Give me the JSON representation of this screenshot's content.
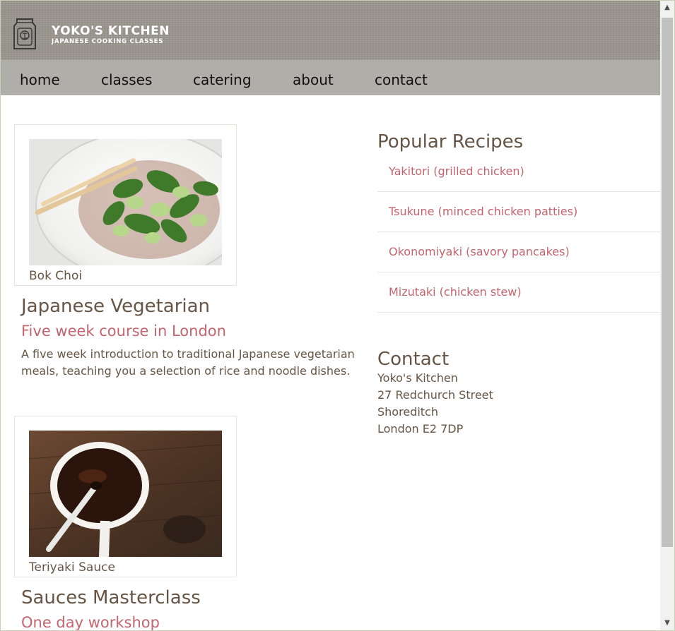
{
  "brand": {
    "title": "YOKO'S KITCHEN",
    "subtitle": "JAPANESE COOKING CLASSES",
    "logo_icon": "jar-logo-icon"
  },
  "nav": {
    "items": [
      {
        "label": "home"
      },
      {
        "label": "classes"
      },
      {
        "label": "catering"
      },
      {
        "label": "about"
      },
      {
        "label": "contact"
      }
    ]
  },
  "articles": [
    {
      "caption": "Bok Choi",
      "title": "Japanese Vegetarian",
      "subtitle": "Five week course in London",
      "body": "A five week introduction to traditional Japanese vegetarian meals, teaching you a selection of rice and noodle dishes."
    },
    {
      "caption": "Teriyaki Sauce",
      "title": "Sauces Masterclass",
      "subtitle": "One day workshop"
    }
  ],
  "aside": {
    "recipes_title": "Popular Recipes",
    "recipes": [
      {
        "label": "Yakitori (grilled chicken)"
      },
      {
        "label": "Tsukune (minced chicken patties)"
      },
      {
        "label": "Okonomiyaki (savory pancakes)"
      },
      {
        "label": "Mizutaki (chicken stew)"
      }
    ],
    "contact_title": "Contact",
    "contact_lines": [
      "Yoko's Kitchen",
      "27 Redchurch Street",
      "Shoreditch",
      "London E2 7DP"
    ]
  },
  "colors": {
    "header_bg": "#9c9890",
    "nav_bg": "#b0aea9",
    "text": "#665544",
    "accent": "#c5646e"
  }
}
